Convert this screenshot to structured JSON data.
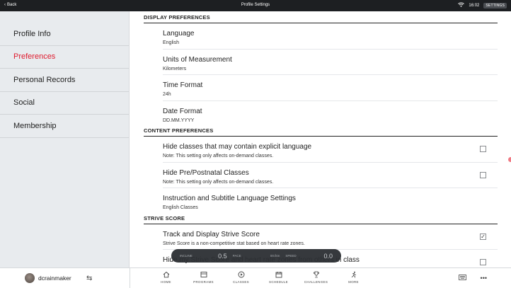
{
  "topbar": {
    "back_label": "Back",
    "title": "Profile Settings",
    "time": "16:02",
    "settings_label": "SETTINGS"
  },
  "sidebar": {
    "items": [
      {
        "label": "Profile Info"
      },
      {
        "label": "Preferences"
      },
      {
        "label": "Personal Records"
      },
      {
        "label": "Social"
      },
      {
        "label": "Membership"
      }
    ]
  },
  "display_preferences": {
    "header": "DISPLAY PREFERENCES",
    "rows": [
      {
        "title": "Language",
        "value": "English"
      },
      {
        "title": "Units of Measurement",
        "value": "Kilometers"
      },
      {
        "title": "Time Format",
        "value": "24h"
      },
      {
        "title": "Date Format",
        "value": "DD.MM.YYYY"
      }
    ]
  },
  "content_preferences": {
    "header": "CONTENT PREFERENCES",
    "rows": [
      {
        "title": "Hide classes that may contain explicit language",
        "note": "Note: This setting only affects on-demand classes.",
        "checked": false
      },
      {
        "title": "Hide Pre/Postnatal Classes",
        "note": "Note: This setting only affects on-demand classes.",
        "checked": false
      },
      {
        "title": "Instruction and Subtitle Language Settings",
        "note": "English Classes"
      }
    ]
  },
  "strive_score": {
    "header": "STRIVE SCORE",
    "rows": [
      {
        "title": "Track and Display Strive Score",
        "note": "Strive Score is a non-competitive stat based on heart rate zones.",
        "checked": true
      },
      {
        "title": "Hide my Strive Score and heart rate zones from others in class",
        "checked": false
      }
    ]
  },
  "metrics": {
    "incline_label": "INCLINE",
    "incline_value": "0.5",
    "pace_label": "PACE",
    "pace_value": "00:/km",
    "speed_label": "SPEED",
    "speed_value": "0.0"
  },
  "bottombar": {
    "username": "dcrainmaker",
    "nav": [
      {
        "label": "HOME",
        "icon": "home-icon"
      },
      {
        "label": "PROGRAMS",
        "icon": "programs-icon"
      },
      {
        "label": "CLASSES",
        "icon": "play-icon"
      },
      {
        "label": "SCHEDULE",
        "icon": "calendar-icon"
      },
      {
        "label": "CHALLENGES",
        "icon": "trophy-icon"
      },
      {
        "label": "MORE",
        "icon": "runner-icon"
      }
    ]
  },
  "colors": {
    "accent": "#df1c2f",
    "sidebar_bg": "#e8ebee",
    "topbar_bg": "#1d1f22"
  }
}
